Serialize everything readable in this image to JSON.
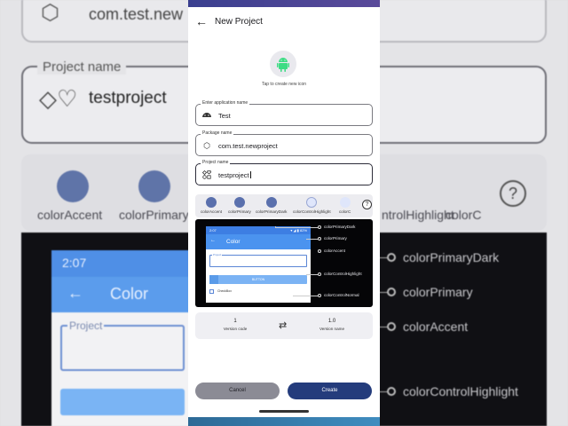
{
  "background": {
    "package_value": "com.test.new",
    "project_name_label": "Project name",
    "project_name_value": "testproject",
    "color_labels": [
      "colorAccent",
      "colorPrimary",
      "ntrolHighlight",
      "colorC"
    ],
    "preview_status_time": "2:07",
    "preview_title": "Color",
    "preview_field_label": "Project",
    "annotations": [
      "colorPrimaryDark",
      "colorPrimary",
      "colorAccent",
      "colorControlHighlight"
    ]
  },
  "appbar": {
    "title": "New Project"
  },
  "app_icon": {
    "caption": "Tap to create new icon",
    "icon": "android-icon"
  },
  "fields": {
    "app_name": {
      "label": "Enter application name",
      "value": "Test"
    },
    "package": {
      "label": "Package name",
      "value": "com.test.newproject"
    },
    "project": {
      "label": "Project name",
      "value": "testproject"
    }
  },
  "colors": [
    {
      "label": "colorAccent",
      "hex": "#5a70ad"
    },
    {
      "label": "colorPrimary",
      "hex": "#5a70ad"
    },
    {
      "label": "colorPrimaryDark",
      "hex": "#5a70ad"
    },
    {
      "label": "colorControlHighlight",
      "hex": "#dfe6fb"
    },
    {
      "label": "colorC",
      "hex": "#dfe6fb"
    }
  ],
  "preview": {
    "status_time": "2:07",
    "status_right": "▾ ◢ ▮ 82%",
    "toolbar_title": "Color",
    "field_label": "Project",
    "button_label": "BUTTON",
    "checkbox_label": "CheckBox",
    "annotations": [
      "colorPrimaryDark",
      "colorPrimary",
      "colorAccent",
      "colorControlHighlight",
      "colorControlNormal"
    ]
  },
  "version": {
    "code_value": "1",
    "code_label": "Version code",
    "name_value": "1.0",
    "name_label": "Version name"
  },
  "actions": {
    "cancel": "Cancel",
    "create": "Create"
  },
  "theme": {
    "accent": "#243c7c",
    "primary_blue": "#4b93ef",
    "dot_blue": "#5a70ad"
  }
}
